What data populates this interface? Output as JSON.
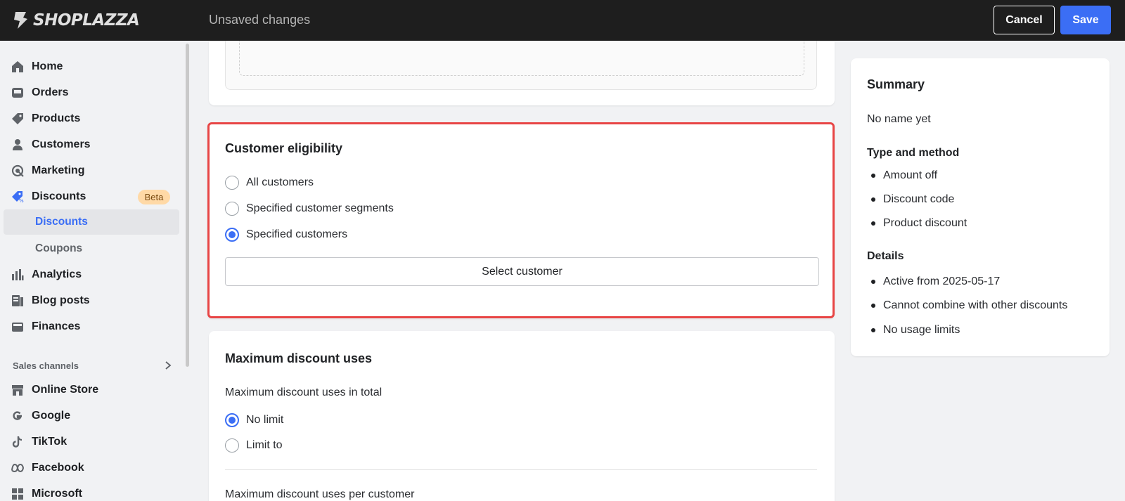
{
  "topbar": {
    "logo_text": "SHOPLAZZA",
    "status": "Unsaved changes",
    "cancel_label": "Cancel",
    "save_label": "Save"
  },
  "sidebar": {
    "items": [
      {
        "label": "Home",
        "icon": "home-icon"
      },
      {
        "label": "Orders",
        "icon": "inbox-icon"
      },
      {
        "label": "Products",
        "icon": "tag-icon"
      },
      {
        "label": "Customers",
        "icon": "person-icon"
      },
      {
        "label": "Marketing",
        "icon": "target-icon"
      },
      {
        "label": "Discounts",
        "icon": "discount-tag-icon",
        "badge": "Beta"
      },
      {
        "label": "Discounts",
        "sub": true,
        "active": true
      },
      {
        "label": "Coupons",
        "sub": true
      },
      {
        "label": "Analytics",
        "icon": "bar-chart-icon"
      },
      {
        "label": "Blog posts",
        "icon": "document-icon"
      },
      {
        "label": "Finances",
        "icon": "wallet-icon"
      }
    ],
    "sales_channels_label": "Sales channels",
    "channels": [
      {
        "label": "Online Store",
        "icon": "store-icon"
      },
      {
        "label": "Google",
        "icon": "google-icon"
      },
      {
        "label": "TikTok",
        "icon": "tiktok-icon"
      },
      {
        "label": "Facebook",
        "icon": "meta-icon"
      },
      {
        "label": "Microsoft",
        "icon": "microsoft-icon"
      }
    ]
  },
  "eligibility": {
    "title": "Customer eligibility",
    "options": [
      {
        "label": "All customers",
        "checked": false
      },
      {
        "label": "Specified customer segments",
        "checked": false
      },
      {
        "label": "Specified customers",
        "checked": true
      }
    ],
    "select_button": "Select customer",
    "highlight_color": "#e84545"
  },
  "max_uses": {
    "title": "Maximum discount uses",
    "total_heading": "Maximum discount uses in total",
    "options": [
      {
        "label": "No limit",
        "checked": true
      },
      {
        "label": "Limit to",
        "checked": false
      }
    ],
    "per_customer_heading": "Maximum discount uses per customer"
  },
  "summary": {
    "title": "Summary",
    "name": "No name yet",
    "type_heading": "Type and method",
    "type_items": [
      "Amount off",
      "Discount code",
      "Product discount"
    ],
    "details_heading": "Details",
    "details_items": [
      "Active from 2025-05-17",
      "Cannot combine with other discounts",
      "No usage limits"
    ]
  },
  "colors": {
    "accent": "#3b6ef5",
    "topbar": "#1e1e1e",
    "beta_badge": "#ffd9a6"
  }
}
